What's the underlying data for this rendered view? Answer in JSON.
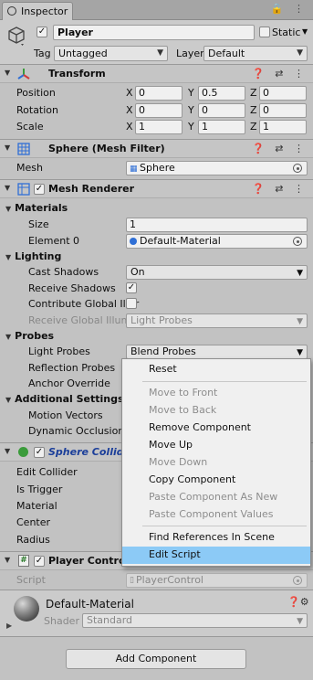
{
  "window": {
    "tab_label": "Inspector",
    "tab_icons": "🔒 ⋮"
  },
  "gameobject": {
    "active": "✓",
    "name": "Player",
    "static_label": "Static",
    "static_checked": "",
    "tag_label": "Tag",
    "tag_value": "Untagged",
    "layer_label": "Layer",
    "layer_value": "Default"
  },
  "transform": {
    "title": "Transform",
    "position_label": "Position",
    "position": {
      "x": "0",
      "y": "0.5",
      "z": "0"
    },
    "rotation_label": "Rotation",
    "rotation": {
      "x": "0",
      "y": "0",
      "z": "0"
    },
    "scale_label": "Scale",
    "scale": {
      "x": "1",
      "y": "1",
      "z": "1"
    },
    "axes": {
      "x": "X",
      "y": "Y",
      "z": "Z"
    }
  },
  "mesh_filter": {
    "title": "Sphere (Mesh Filter)",
    "mesh_label": "Mesh",
    "mesh_value": "Sphere"
  },
  "mesh_renderer": {
    "title": "Mesh Renderer",
    "materials_label": "Materials",
    "size_label": "Size",
    "size_value": "1",
    "element0_label": "Element 0",
    "element0_value": "Default-Material",
    "lighting_label": "Lighting",
    "cast_shadows_label": "Cast Shadows",
    "cast_shadows_value": "On",
    "receive_shadows_label": "Receive Shadows",
    "receive_shadows_checked": "✓",
    "contribute_gi_label": "Contribute Global Illur",
    "receive_gi_label": "Receive Global Illumir",
    "receive_gi_value": "Light Probes",
    "probes_label": "Probes",
    "light_probes_label": "Light Probes",
    "light_probes_value": "Blend Probes",
    "reflection_probes_label": "Reflection Probes",
    "anchor_override_label": "Anchor Override",
    "additional_label": "Additional Settings",
    "motion_vectors_label": "Motion Vectors",
    "dynamic_occlusion_label": "Dynamic Occlusion"
  },
  "sphere_collider": {
    "title": "Sphere Collider",
    "edit_collider_label": "Edit Collider",
    "is_trigger_label": "Is Trigger",
    "material_label": "Material",
    "center_label": "Center",
    "radius_label": "Radius"
  },
  "player_control": {
    "title": "Player Control (",
    "script_label": "Script",
    "script_value": "PlayerControl"
  },
  "material": {
    "name": "Default-Material",
    "shader_label": "Shader",
    "shader_value": "Standard"
  },
  "add_component_label": "Add Component",
  "context_menu": {
    "items": [
      {
        "label": "Reset",
        "enabled": true
      },
      {
        "label": "Move to Front",
        "enabled": false
      },
      {
        "label": "Move to Back",
        "enabled": false
      },
      {
        "label": "Remove Component",
        "enabled": true
      },
      {
        "label": "Move Up",
        "enabled": true
      },
      {
        "label": "Move Down",
        "enabled": false
      },
      {
        "label": "Copy Component",
        "enabled": true
      },
      {
        "label": "Paste Component As New",
        "enabled": false
      },
      {
        "label": "Paste Component Values",
        "enabled": false
      },
      {
        "label": "Find References In Scene",
        "enabled": true
      },
      {
        "label": "Edit Script",
        "enabled": true,
        "highlighted": true
      }
    ]
  },
  "colors": {
    "panel": "#c2c2c2",
    "header": "#c5c5c5",
    "menu_highlight": "#8ccaf6",
    "collider_title": "#1c3f9a"
  }
}
